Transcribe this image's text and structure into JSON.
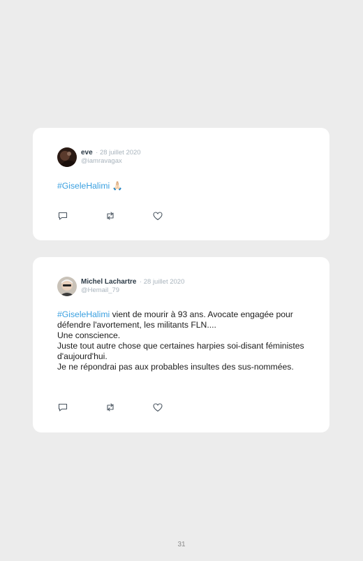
{
  "tweets": [
    {
      "name": "eve",
      "date": "· 28 juillet 2020",
      "handle": "@iamravagax",
      "hashtag": "#GiseleHalimi",
      "text": " 🙏🏻",
      "lines": []
    },
    {
      "name": "Michel Lachartre",
      "date": "· 28 juillet 2020",
      "handle": "@Hemail_79",
      "hashtag": "#GiseleHalimi",
      "text": " vient de mourir à 93 ans. Avocate engagée pour défendre l'avortement, les militants FLN....",
      "lines": [
        "Une conscience.",
        "Juste tout autre chose que certaines harpies soi-disant féministes d'aujourd'hui.",
        "Je ne répondrai pas aux probables insultes des sus-nommées."
      ]
    }
  ],
  "icons": [
    "reply-icon",
    "retweet-icon",
    "like-icon"
  ],
  "page_number": "31"
}
